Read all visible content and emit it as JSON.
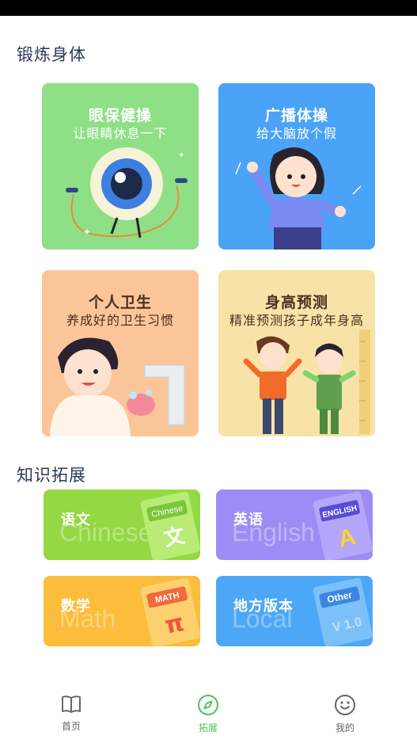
{
  "sections": {
    "exercise_title": "锻炼身体",
    "knowledge_title": "知识拓展"
  },
  "cards": [
    {
      "title": "眼保健操",
      "subtitle": "让眼睛休息一下",
      "bg": "#8fdf86",
      "title_color": "#ffffff"
    },
    {
      "title": "广播体操",
      "subtitle": "给大脑放个假",
      "bg": "#4aa3f7",
      "title_color": "#ffffff"
    },
    {
      "title": "个人卫生",
      "subtitle": "养成好的卫生习惯",
      "bg": "#fbc59a",
      "title_color": "#4a3020"
    },
    {
      "title": "身高预测",
      "subtitle": "精准预测孩子成年身高",
      "bg": "#f7e3a8",
      "title_color": "#4a3020"
    }
  ],
  "subjects": [
    {
      "label": "语文",
      "ghost": "Chinese",
      "book_text": "Chinese",
      "book_glyph": "文",
      "bg": "#94d844"
    },
    {
      "label": "英语",
      "ghost": "English",
      "book_text": "ENGLISH",
      "book_glyph": "A",
      "bg": "#9d8cf6"
    },
    {
      "label": "数学",
      "ghost": "Math",
      "book_text": "MATH",
      "book_glyph": "π",
      "bg": "#fbbd3b"
    },
    {
      "label": "地方版本",
      "ghost": "Local",
      "book_text": "Other",
      "book_glyph": "V 1.0",
      "bg": "#4da7f7"
    }
  ],
  "nav": {
    "items": [
      {
        "label": "首页",
        "icon": "book-icon",
        "active": false
      },
      {
        "label": "拓展",
        "icon": "compass-icon",
        "active": true
      },
      {
        "label": "我的",
        "icon": "smiley-icon",
        "active": false
      }
    ],
    "active_color": "#4bc35a",
    "inactive_color": "#666666"
  }
}
